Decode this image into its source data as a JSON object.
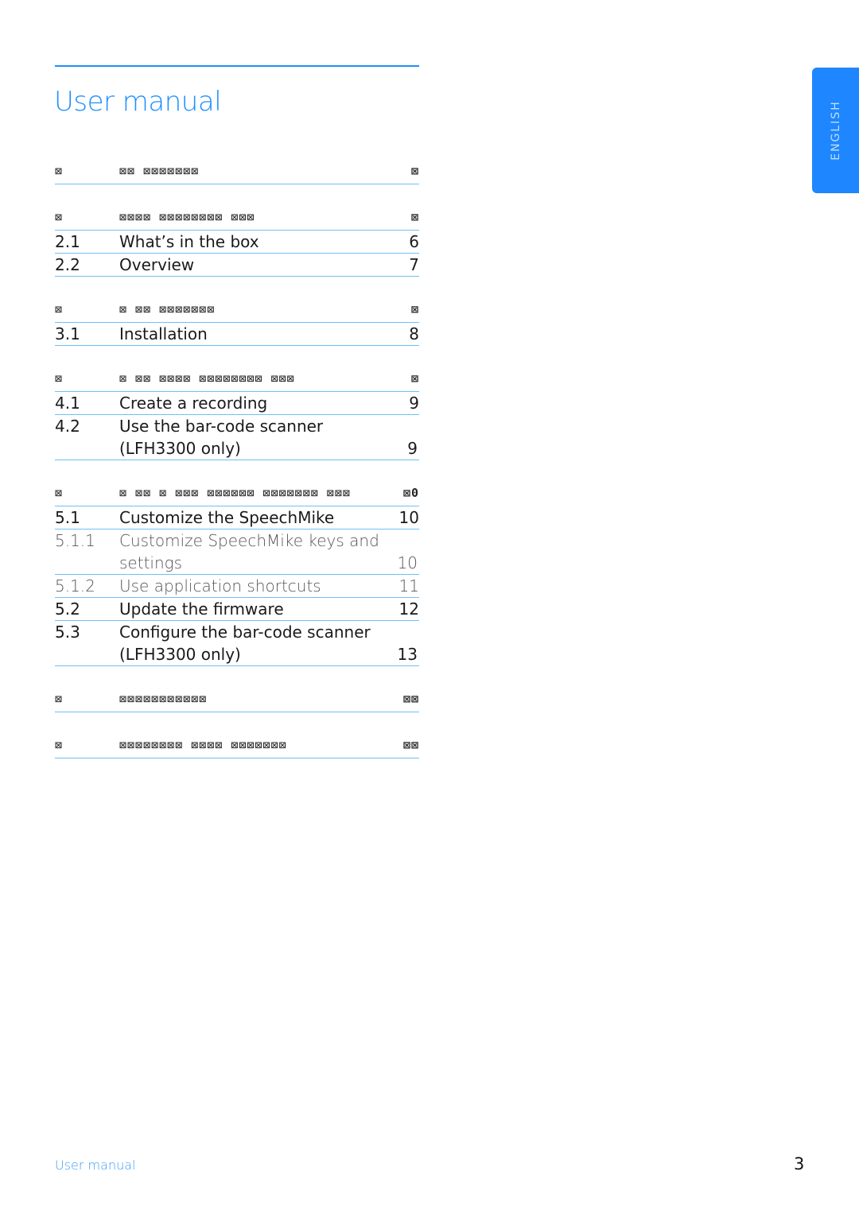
{
  "header": {
    "title": "User manual"
  },
  "side_tab": {
    "language": "ENGLISH"
  },
  "toc": [
    {
      "type": "heading",
      "num": "⊠",
      "text": "⊠⊠ ⊠⊠⊠⊠⊠⊠⊠",
      "page": "⊠"
    },
    {
      "type": "gap"
    },
    {
      "type": "heading",
      "num": "⊠",
      "text": "⊠⊠⊠⊠ ⊠⊠⊠⊠⊠⊠⊠⊠ ⊠⊠⊠",
      "page": "⊠"
    },
    {
      "type": "section",
      "num": "2.1",
      "text": "What’s in the box",
      "page": "6"
    },
    {
      "type": "section",
      "num": "2.2",
      "text": "Overview",
      "page": "7"
    },
    {
      "type": "gap"
    },
    {
      "type": "heading",
      "num": "⊠",
      "text": "⊠ ⊠⊠ ⊠⊠⊠⊠⊠⊠⊠",
      "page": "⊠"
    },
    {
      "type": "section",
      "num": "3.1",
      "text": "Installation",
      "page": "8"
    },
    {
      "type": "gap"
    },
    {
      "type": "heading",
      "num": "⊠",
      "text": "⊠ ⊠⊠ ⊠⊠⊠⊠ ⊠⊠⊠⊠⊠⊠⊠⊠ ⊠⊠⊠",
      "page": "⊠"
    },
    {
      "type": "section",
      "num": "4.1",
      "text": "Create a recording",
      "page": "9"
    },
    {
      "type": "section-multi",
      "num": "4.2",
      "text": "Use the bar-code scanner (LFH3300 only)",
      "page": "9"
    },
    {
      "type": "gap"
    },
    {
      "type": "heading",
      "num": "⊠",
      "text": "⊠ ⊠⊠ ⊠ ⊠⊠⊠ ⊠⊠⊠⊠⊠⊠ ⊠⊠⊠⊠⊠⊠⊠ ⊠⊠⊠",
      "page": "⊠0"
    },
    {
      "type": "section",
      "num": "5.1",
      "text": "Customize the SpeechMike",
      "page": "10"
    },
    {
      "type": "sub-multi",
      "num": "5.1.1",
      "text": "Customize SpeechMike keys and settings",
      "page": "10"
    },
    {
      "type": "sub",
      "num": "5.1.2",
      "text": "Use application shortcuts",
      "page": "11"
    },
    {
      "type": "section",
      "num": "5.2",
      "text": "Update the firmware",
      "page": "12"
    },
    {
      "type": "section-multi",
      "num": "5.3",
      "text": "Configure the bar-code scanner (LFH3300 only)",
      "page": "13"
    },
    {
      "type": "gap"
    },
    {
      "type": "heading",
      "num": "⊠",
      "text": "⊠⊠⊠⊠⊠⊠⊠⊠⊠⊠⊠",
      "page": "⊠⊠"
    },
    {
      "type": "gap"
    },
    {
      "type": "heading",
      "num": "⊠",
      "text": "⊠⊠⊠⊠⊠⊠⊠⊠ ⊠⊠⊠⊠ ⊠⊠⊠⊠⊠⊠⊠",
      "page": "⊠⊠"
    }
  ],
  "footer": {
    "title": "User manual",
    "page_number": "3"
  },
  "colors": {
    "accent": "#1e8fff",
    "rule": "#6ec0f5",
    "tab": "#1e86ff"
  }
}
